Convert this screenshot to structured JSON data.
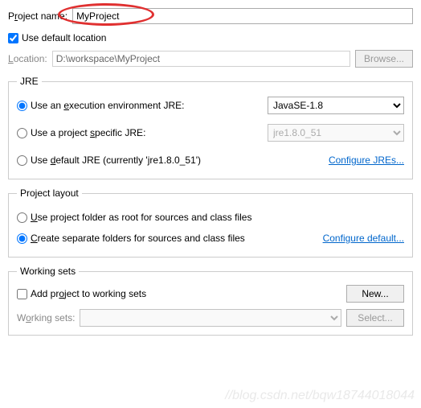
{
  "projectName": {
    "label_pre": "P",
    "label_u": "r",
    "label_post": "oject name:",
    "value": "MyProject"
  },
  "useDefaultLocation": {
    "label": "Use default location",
    "checked": true
  },
  "location": {
    "label_u": "L",
    "label_post": "ocation:",
    "value": "D:\\workspace\\MyProject",
    "browse_u": "B",
    "browse_post": "rowse..."
  },
  "jre": {
    "legend": "JRE",
    "opt_exec_env": {
      "label_pre": "Use an ",
      "label_u": "e",
      "label_post": "xecution environment JRE:",
      "selected": "JavaSE-1.8",
      "checked": true
    },
    "opt_specific": {
      "label_pre": "Use a project ",
      "label_u": "s",
      "label_post": "pecific JRE:",
      "selected": "jre1.8.0_51",
      "checked": false
    },
    "opt_default": {
      "label_pre": "Use ",
      "label_u": "d",
      "label_post": "efault JRE (currently 'jre1.8.0_51')",
      "checked": false
    },
    "configure_link": "Configure JREs..."
  },
  "layout": {
    "legend": "Project layout",
    "opt_root": {
      "label_u": "U",
      "label_post": "se project folder as root for sources and class files",
      "checked": false
    },
    "opt_separate": {
      "label_u": "C",
      "label_post": "reate separate folders for sources and class files",
      "checked": true
    },
    "configure_link": "Configure default..."
  },
  "workingSets": {
    "legend": "Working sets",
    "add": {
      "label_pre": "Add pr",
      "label_u": "o",
      "label_post": "ject to working sets",
      "checked": false
    },
    "new_label_pre": "Ne",
    "new_label_u": "w",
    "new_label_post": "...",
    "combo_label_pre": "W",
    "combo_label_u": "o",
    "combo_label_post": "rking sets:",
    "select_label_pre": "S",
    "select_label_u": "e",
    "select_label_post": "lect..."
  },
  "watermark": "//blog.csdn.net/bqw18744018044"
}
